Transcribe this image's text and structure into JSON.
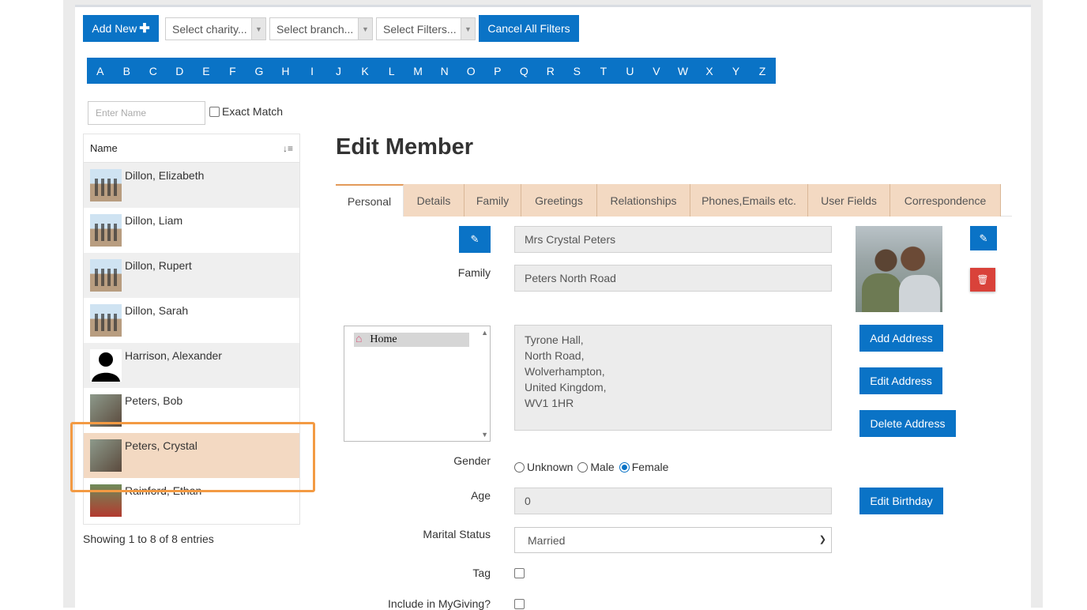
{
  "toolbar": {
    "add_new_label": "Add New",
    "add_new_icon": "plus-icon",
    "charity_placeholder": "Select charity...",
    "branch_placeholder": "Select branch...",
    "filters_placeholder": "Select Filters...",
    "cancel_filters_label": "Cancel All Filters"
  },
  "alphabet": [
    "A",
    "B",
    "C",
    "D",
    "E",
    "F",
    "G",
    "H",
    "I",
    "J",
    "K",
    "L",
    "M",
    "N",
    "O",
    "P",
    "Q",
    "R",
    "S",
    "T",
    "U",
    "V",
    "W",
    "X",
    "Y",
    "Z"
  ],
  "search": {
    "name_placeholder": "Enter Name",
    "exact_match_label": "Exact Match",
    "exact_match_checked": false
  },
  "member_list": {
    "header": "Name",
    "sort_icon": "sort-alpha-icon",
    "rows": [
      {
        "name": "Dillon, Elizabeth",
        "thumb": "beach"
      },
      {
        "name": "Dillon, Liam",
        "thumb": "beach"
      },
      {
        "name": "Dillon, Rupert",
        "thumb": "beach"
      },
      {
        "name": "Dillon, Sarah",
        "thumb": "beach"
      },
      {
        "name": "Harrison, Alexander",
        "thumb": "silhouette"
      },
      {
        "name": "Peters, Bob",
        "thumb": "couple"
      },
      {
        "name": "Peters, Crystal",
        "thumb": "couple",
        "selected": true
      },
      {
        "name": "Rainford, Ethan",
        "thumb": "ethan"
      }
    ],
    "showing_text": "Showing 1 to 8 of 8 entries"
  },
  "edit": {
    "title": "Edit Member",
    "tabs": [
      "Personal",
      "Details",
      "Family",
      "Greetings",
      "Relationships",
      "Phones,Emails etc.",
      "User Fields",
      "Correspondence"
    ],
    "active_tab": "Personal",
    "full_name": "Mrs Crystal Peters",
    "family_label": "Family",
    "family_value": "Peters North Road",
    "address_types": [
      "Home"
    ],
    "address_lines": [
      "Tyrone Hall,",
      "North Road,",
      "Wolverhampton,",
      "United Kingdom,",
      "WV1 1HR"
    ],
    "add_address_label": "Add Address",
    "edit_address_label": "Edit Address",
    "delete_address_label": "Delete Address",
    "gender_label": "Gender",
    "gender_options": [
      "Unknown",
      "Male",
      "Female"
    ],
    "gender_selected": "Female",
    "age_label": "Age",
    "age_value": "0",
    "edit_birthday_label": "Edit Birthday",
    "marital_label": "Marital Status",
    "marital_value": "Married",
    "tag_label": "Tag",
    "mygiving_label": "Include in MyGiving?"
  },
  "colors": {
    "primary": "#0a73c6",
    "tab_bg": "#f3d9c2",
    "selected_row": "#f3d9c2",
    "highlight_border": "#f39a43",
    "danger": "#d9423a"
  }
}
